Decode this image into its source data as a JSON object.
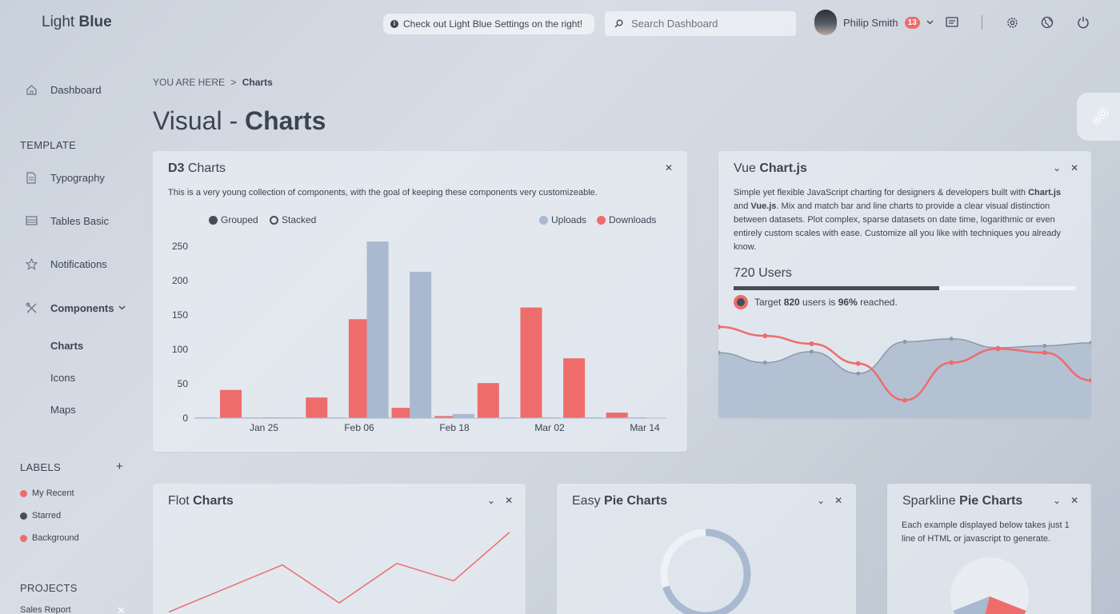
{
  "header": {
    "logo_light": "Light",
    "logo_bold": "Blue",
    "notice": "Check out Light Blue Settings on the right!",
    "search_placeholder": "Search Dashboard",
    "user_name": "Philip Smith",
    "notifications": "13"
  },
  "sidebar": {
    "dashboard": "Dashboard",
    "template_heading": "TEMPLATE",
    "typography": "Typography",
    "tables": "Tables Basic",
    "notifications": "Notifications",
    "components": "Components",
    "sub_charts": "Charts",
    "sub_icons": "Icons",
    "sub_maps": "Maps",
    "labels_heading": "LABELS",
    "labels": [
      {
        "text": "My Recent",
        "color": "#ee6c6c"
      },
      {
        "text": "Starred",
        "color": "#474d57"
      },
      {
        "text": "Background",
        "color": "#ee6c6c"
      }
    ],
    "projects_heading": "PROJECTS",
    "project_1": "Sales Report"
  },
  "breadcrumb": {
    "prefix": "YOU ARE HERE",
    "sep": ">",
    "current": "Charts"
  },
  "page_title": {
    "light": "Visual - ",
    "bold": "Charts"
  },
  "d3_card": {
    "title_bold": "D3",
    "title_rest": " Charts",
    "description": "This is a very young collection of components, with the goal of keeping these components very customizeable.",
    "mode_grouped": "Grouped",
    "mode_stacked": "Stacked",
    "legend_uploads": "Uploads",
    "legend_downloads": "Downloads"
  },
  "vue_card": {
    "title_light": "Vue ",
    "title_bold": "Chart.js",
    "desc_1": "Simple yet flexible JavaScript charting for designers & developers built with ",
    "desc_b1": "Chart.js",
    "desc_2": " and ",
    "desc_b2": "Vue.js",
    "desc_3": ". Mix and match bar and line charts to provide a clear visual distinction between datasets. Plot complex, sparse datasets on date time, logarithmic or even entirely custom scales with ease. Customize all you like with techniques you already know.",
    "users_label": "720 Users",
    "progress": 0.6,
    "target_1": "Target ",
    "target_b1": "820",
    "target_2": " users is ",
    "target_b2": "96%",
    "target_3": " reached."
  },
  "flot_card": {
    "title_light": "Flot ",
    "title_bold": "Charts"
  },
  "pie_card": {
    "title_light": "Easy ",
    "title_bold": "Pie Charts"
  },
  "spark_card": {
    "title_light": "Sparkline ",
    "title_bold": "Pie Charts",
    "description": "Each example displayed below takes just 1 line of HTML or javascript to generate."
  },
  "colors": {
    "upload": "#a9b9cf",
    "download": "#ee6c6c",
    "dark": "#474d57"
  },
  "chart_data": [
    {
      "type": "bar",
      "y_ticks": [
        0,
        50,
        100,
        150,
        200,
        250
      ],
      "ylim": [
        0,
        260
      ],
      "x_tick_labels": [
        "Jan 25",
        "Feb 06",
        "Feb 18",
        "Mar 02",
        "Mar 14"
      ],
      "series": [
        {
          "name": "Uploads",
          "values": [
            1,
            1,
            1,
            1,
            257,
            213,
            6,
            1,
            1,
            1,
            1
          ]
        },
        {
          "name": "Downloads",
          "values": [
            41,
            1,
            30,
            144,
            15,
            3,
            51,
            161,
            87,
            8,
            0
          ]
        }
      ],
      "grid": false,
      "legend": "top-right"
    },
    {
      "type": "line",
      "series": [
        {
          "name": "upload-area",
          "values": [
            66,
            56,
            67,
            45,
            77,
            80,
            71,
            73,
            76
          ]
        },
        {
          "name": "download-line",
          "values": [
            92,
            83,
            75,
            55,
            18,
            56,
            70,
            66,
            38
          ]
        }
      ]
    },
    {
      "type": "line",
      "series": [
        {
          "name": "flot-line",
          "values": [
            10,
            72,
            22,
            74,
            51,
            115
          ]
        }
      ]
    },
    {
      "type": "pie",
      "values": [
        70,
        30
      ]
    },
    {
      "type": "pie",
      "values": [
        62,
        23,
        15
      ]
    }
  ]
}
